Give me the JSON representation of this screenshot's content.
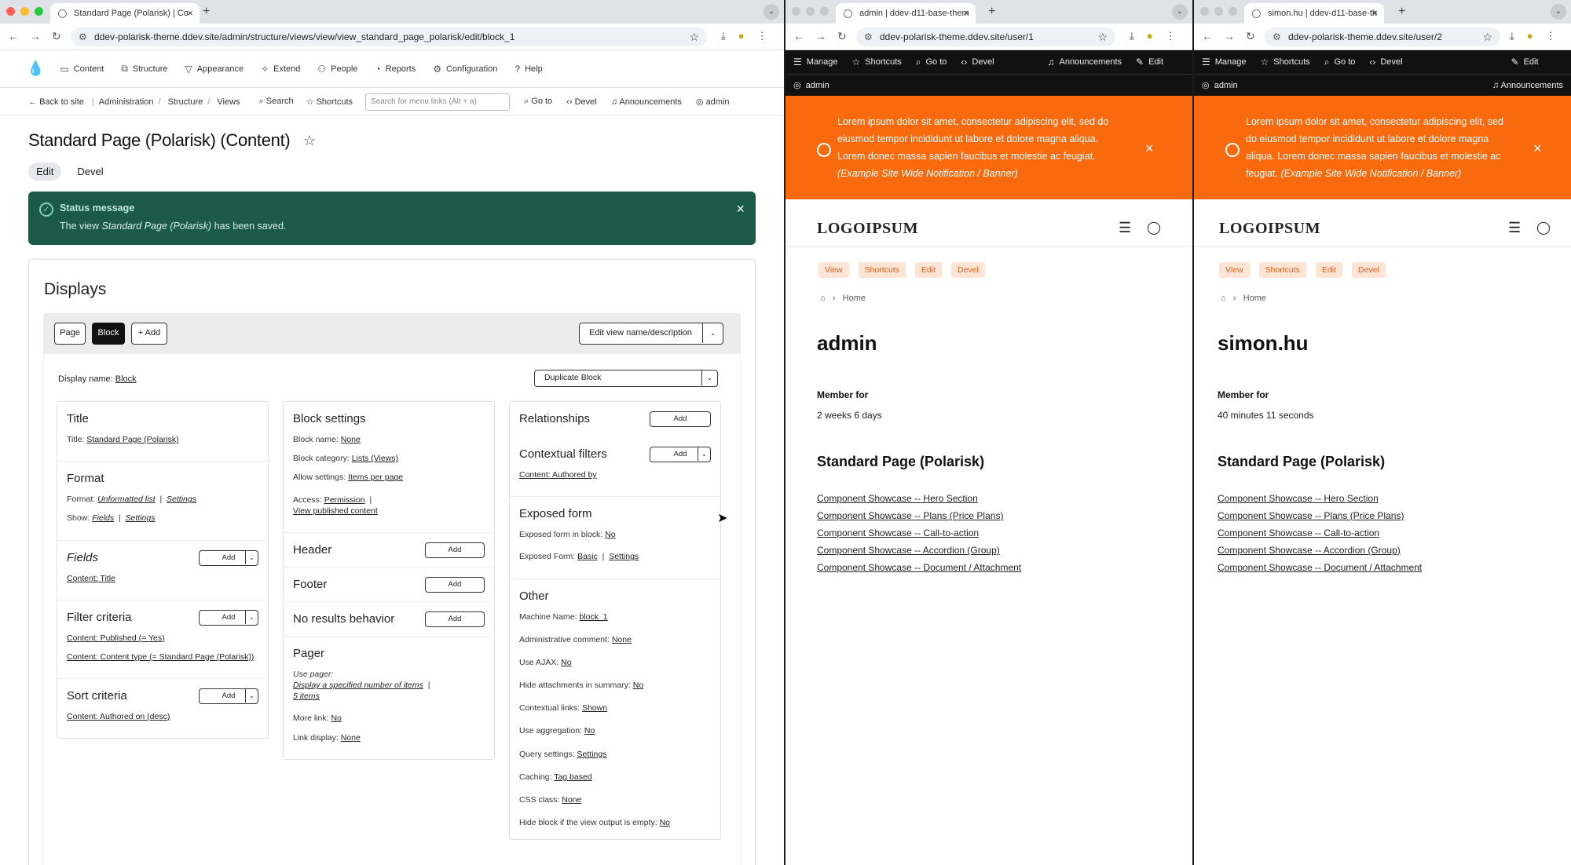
{
  "colors": {
    "status_bg": "#1b5a48",
    "banner": "#f96a0f",
    "pill_bg": "#fde4d4",
    "pill_text": "#e2621a"
  },
  "left": {
    "tab_title": "Standard Page (Polarisk) | Co",
    "url": "ddev-polarisk-theme.ddev.site/admin/structure/views/view/view_standard_page_polarisk/edit/block_1",
    "toolbar": [
      {
        "icon": "drupal-drop-icon",
        "label": ""
      },
      {
        "icon": "document-icon",
        "label": "Content"
      },
      {
        "icon": "structure-icon",
        "label": "Structure"
      },
      {
        "icon": "brush-icon",
        "label": "Appearance"
      },
      {
        "icon": "puzzle-icon",
        "label": "Extend"
      },
      {
        "icon": "people-icon",
        "label": "People"
      },
      {
        "icon": "reports-icon",
        "label": "Reports"
      },
      {
        "icon": "gear-icon",
        "label": "Configuration"
      },
      {
        "icon": "help-icon",
        "label": "Help"
      }
    ],
    "back_to_site": "Back to site",
    "breadcrumb": [
      "Administration",
      "Structure",
      "Views"
    ],
    "search_label": "Search",
    "shortcuts_label": "Shortcuts",
    "menu_search_placeholder": "Search for menu links (Alt + a)",
    "goto": "Go to",
    "devel": "Devel",
    "announcements": "Announcements",
    "user": "admin",
    "page_title": "Standard Page (Polarisk) (Content)",
    "local_tabs": [
      "Edit",
      "Devel"
    ],
    "status_title": "Status message",
    "status_pre": "The view ",
    "status_view": "Standard Page (Polarisk)",
    "status_post": " has been saved.",
    "displays_heading": "Displays",
    "display_tabs": {
      "page": "Page",
      "block": "Block",
      "add": "+ Add"
    },
    "edit_view_name": "Edit view name/description",
    "display_name_label": "Display name:",
    "display_name_value": "Block",
    "duplicate": "Duplicate Block",
    "add": "Add",
    "col1": {
      "title_h": "Title",
      "title_label": "Title:",
      "title_value": "Standard Page (Polarisk)",
      "format_h": "Format",
      "format_label": "Format:",
      "format_value": "Unformatted list",
      "format_settings": "Settings",
      "show_label": "Show:",
      "show_value": "Fields",
      "show_settings": "Settings",
      "fields_h": "Fields",
      "fields_value": "Content: Title",
      "filter_h": "Filter criteria",
      "filter1": "Content: Published (= Yes)",
      "filter2": "Content: Content type (= Standard Page (Polarisk))",
      "sort_h": "Sort criteria",
      "sort1": "Content: Authored on (desc)"
    },
    "col2": {
      "block_h": "Block settings",
      "block_name_label": "Block name:",
      "block_name_value": "None",
      "block_cat_label": "Block category:",
      "block_cat_value": "Lists (Views)",
      "allow_label": "Allow settings:",
      "allow_value": "Items per page",
      "access_label": "Access:",
      "access_value": "Permission",
      "access_value2": "View published content",
      "header_h": "Header",
      "footer_h": "Footer",
      "noresults_h": "No results behavior",
      "pager_h": "Pager",
      "use_pager": "Use pager:",
      "pager_value": "Display a specified number of items",
      "pager_items": "5 items",
      "more_label": "More link:",
      "more_value": "No",
      "link_label": "Link display:",
      "link_value": "None"
    },
    "col3": {
      "rel_h": "Relationships",
      "ctx_h": "Contextual filters",
      "ctx_value": "Content: Authored by",
      "exposed_h": "Exposed form",
      "exp_block_label": "Exposed form in block:",
      "exp_block_value": "No",
      "exp_form_label": "Exposed Form:",
      "exp_form_value": "Basic",
      "exp_form_settings": "Settings",
      "other_h": "Other",
      "other_rows": [
        {
          "label": "Machine Name:",
          "value": "block_1"
        },
        {
          "label": "Administrative comment:",
          "value": "None"
        },
        {
          "label": "Use AJAX:",
          "value": "No"
        },
        {
          "label": "Hide attachments in summary:",
          "value": "No"
        },
        {
          "label": "Contextual links:",
          "value": "Shown"
        },
        {
          "label": "Use aggregation:",
          "value": "No"
        },
        {
          "label": "Query settings:",
          "value": "Settings"
        },
        {
          "label": "Caching:",
          "value": "Tag based"
        },
        {
          "label": "CSS class:",
          "value": "None"
        },
        {
          "label": "Hide block if the view output is empty:",
          "value": "No"
        }
      ]
    }
  },
  "site_common": {
    "manage": "Manage",
    "shortcuts": "Shortcuts",
    "goto": "Go to",
    "devel": "Devel",
    "announcements": "Announcements",
    "edit": "Edit",
    "banner_text": "Lorem ipsum dolor sit amet, consectetur adipiscing elit, sed do eiusmod tempor incididunt ut labore et dolore magna aliqua. Lorem donec massa sapien faucibus et molestie ac feugiat.",
    "banner_note": "(Example Site Wide Notification / Banner)",
    "logo": "LOGOIPSUM",
    "pills": [
      "View",
      "Shortcuts",
      "Edit",
      "Devel"
    ],
    "home": "Home",
    "member_for": "Member for",
    "section": "Standard Page (Polarisk)",
    "links": [
      "Component Showcase -- Hero Section",
      "Component Showcase -- Plans (Price Plans)",
      "Component Showcase -- Call-to-action",
      "Component Showcase -- Accordion (Group)",
      "Component Showcase -- Document / Attachment"
    ]
  },
  "mid": {
    "tab_title": "admin | ddev-d11-base-them",
    "url": "ddev-polarisk-theme.ddev.site/user/1",
    "user": "admin",
    "heading": "admin",
    "member_value": "2 weeks 6 days"
  },
  "right": {
    "tab_title": "simon.hu | ddev-d11-base-th",
    "url": "ddev-polarisk-theme.ddev.site/user/2",
    "user": "admin",
    "heading": "simon.hu",
    "member_value": "40 minutes 11 seconds"
  }
}
